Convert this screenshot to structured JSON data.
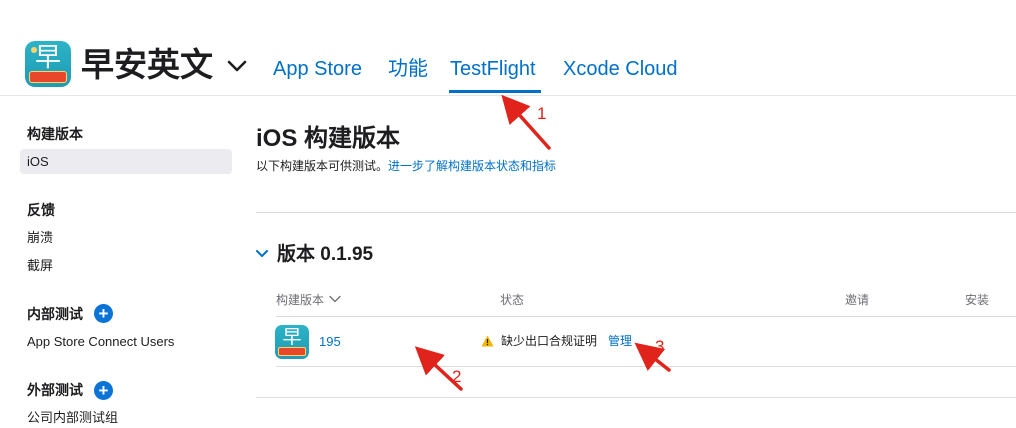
{
  "header": {
    "app_name": "早安英文",
    "app_icon": {
      "glyph": "早",
      "name": "app-icon"
    },
    "tabs": [
      {
        "label": "App Store",
        "active": false
      },
      {
        "label": "功能",
        "active": false
      },
      {
        "label": "TestFlight",
        "active": true
      },
      {
        "label": "Xcode Cloud",
        "active": false
      }
    ],
    "accent_color": "#0070c9"
  },
  "sidebar": {
    "sections": [
      {
        "heading": "构建版本",
        "items": [
          {
            "label": "iOS",
            "selected": true
          }
        ]
      },
      {
        "heading": "反馈",
        "items": [
          {
            "label": "崩溃"
          },
          {
            "label": "截屏"
          }
        ]
      },
      {
        "heading": "内部测试",
        "has_add": true,
        "add_icon": "+",
        "items": [
          {
            "label": "App Store Connect Users"
          }
        ]
      },
      {
        "heading": "外部测试",
        "has_add": true,
        "add_icon": "+",
        "items": [
          {
            "label": "公司内部测试组"
          }
        ]
      }
    ]
  },
  "main": {
    "title": "iOS 构建版本",
    "subtitle": "以下构建版本可供测试。",
    "subtitle_link": "进一步了解构建版本状态和指标",
    "version_title": "版本 0.1.95",
    "columns": [
      "构建版本",
      "状态",
      "邀请",
      "安装"
    ],
    "rows": [
      {
        "build": "195",
        "icon_glyph": "早",
        "status": "缺少出口合规证明",
        "action": "管理",
        "status_icon": "warning-icon",
        "warning_color": "#f5b400"
      }
    ]
  },
  "annotations": {
    "color": "#e0241b",
    "labels": [
      "1",
      "2",
      "3"
    ]
  }
}
